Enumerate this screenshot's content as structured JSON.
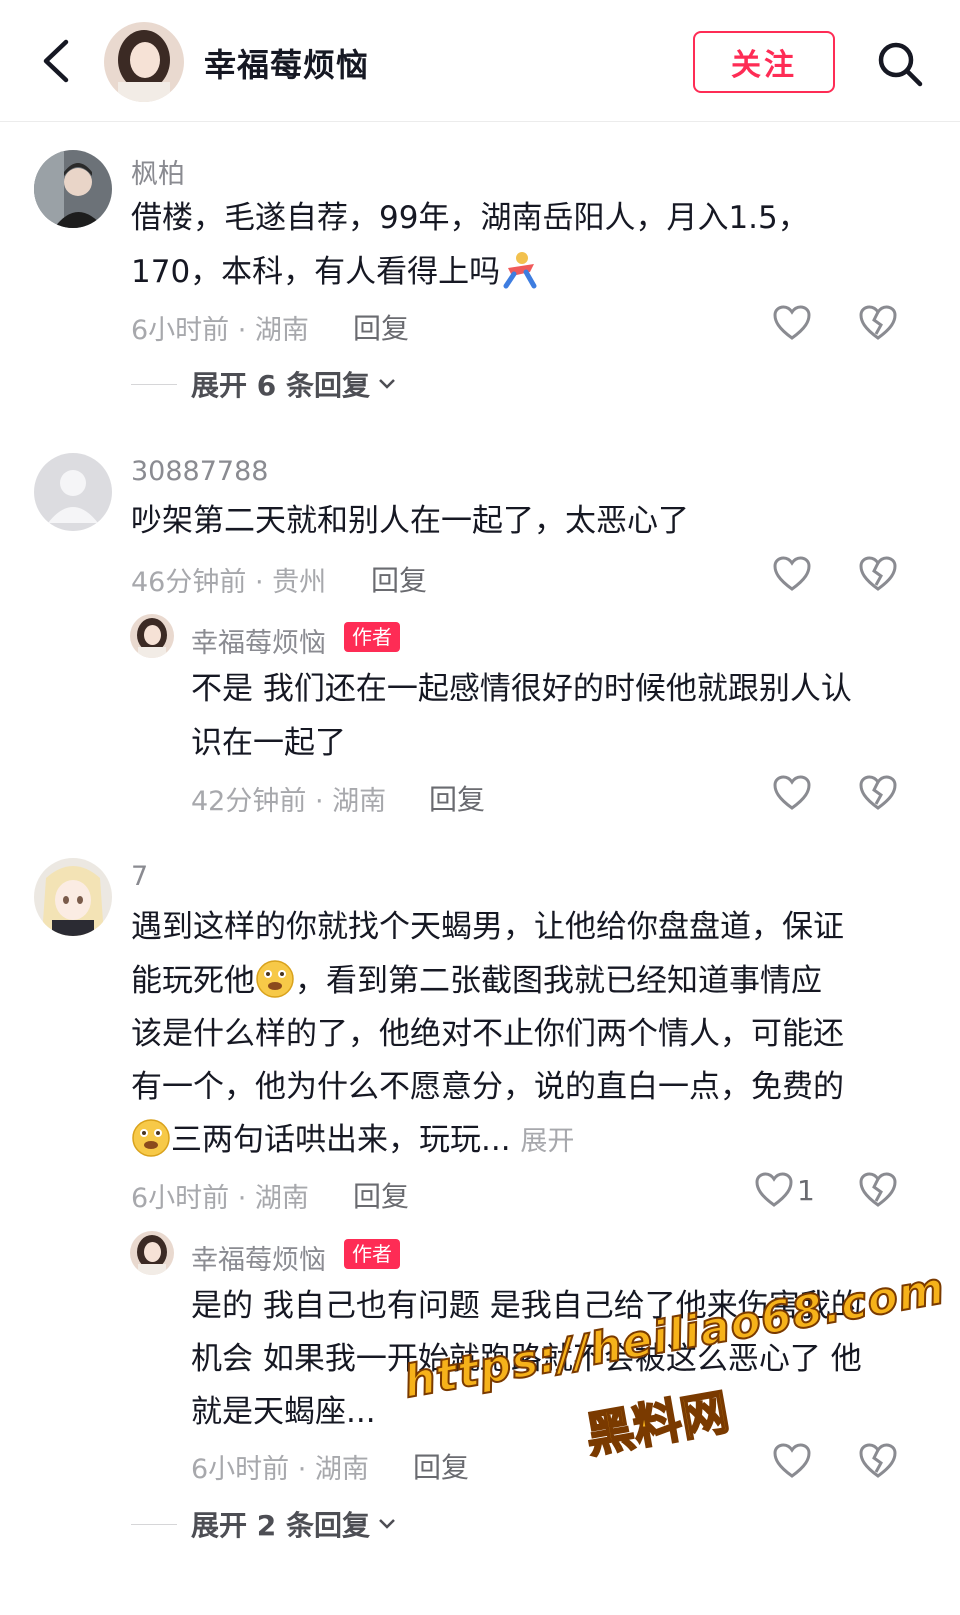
{
  "header": {
    "title": "幸福莓烦恼",
    "follow_label": "关注"
  },
  "comments": [
    {
      "username": "枫柏",
      "text_lines": [
        "借楼，毛遂自荐，99年，湖南岳阳人，月入1.5，",
        "170，本科，有人看得上吗"
      ],
      "time": "6小时前 · 湖南",
      "reply_label": "回复",
      "expand_label": "展开 6 条回复"
    },
    {
      "username": "30887788",
      "text_lines": [
        "吵架第二天就和别人在一起了，太恶心了"
      ],
      "time": "46分钟前 · 贵州",
      "reply_label": "回复",
      "sub_reply": {
        "username": "幸福莓烦恼",
        "tag": "作者",
        "text_lines": [
          "不是 我们还在一起感情很好的时候他就跟别人认",
          "识在一起了"
        ],
        "time": "42分钟前 · 湖南",
        "reply_label": "回复"
      }
    },
    {
      "username": "7",
      "text_lines": [
        "遇到这样的你就找个天蝎男，让他给你盘盘道，保证",
        "能玩死他",
        "，看到第二张截图我就已经知道事情应",
        "该是什么样的了，他绝对不止你们两个情人，可能还",
        "有一个，他为什么不愿意分，说的直白一点，免费的",
        "三两句话哄出来，玩玩..."
      ],
      "more_label": "展开",
      "time": "6小时前 · 湖南",
      "reply_label": "回复",
      "like_count": "1",
      "sub_reply": {
        "username": "幸福莓烦恼",
        "tag": "作者",
        "text_lines": [
          "是的 我自己也有问题 是我自己给了他来伤害我的",
          "机会 如果我一开始就跑路就不会被这么恶心了 他",
          "就是天蝎座..."
        ],
        "time": "6小时前 · 湖南",
        "reply_label": "回复"
      },
      "expand_label": "展开 2 条回复"
    }
  ],
  "watermark": {
    "url": "https://heiliao68.com",
    "name": "黑料网"
  },
  "colors": {
    "accent": "#fe2c55",
    "meta": "#a7a8ac",
    "text": "#161823"
  }
}
